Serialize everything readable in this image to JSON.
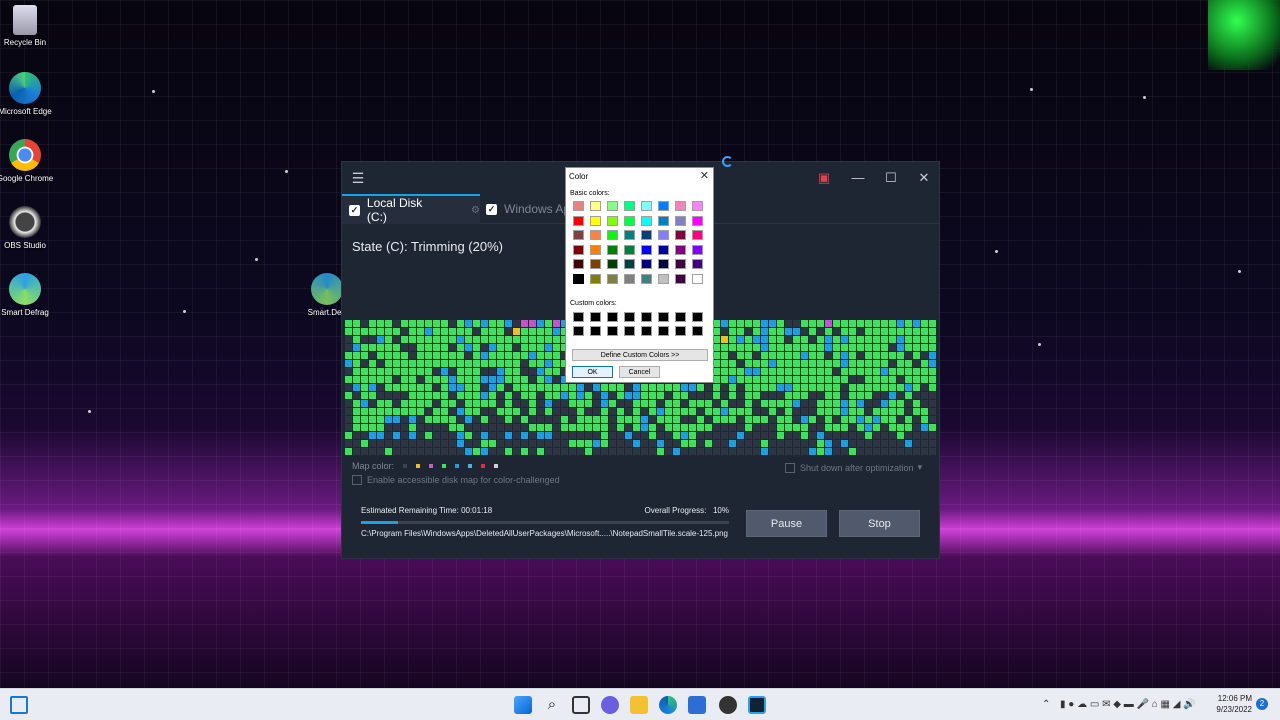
{
  "desktop": {
    "icons": [
      {
        "label": "Recycle Bin",
        "icon": "recycle-bin-icon"
      },
      {
        "label": "Microsoft Edge",
        "icon": "edge-icon"
      },
      {
        "label": "Google Chrome",
        "icon": "chrome-icon"
      },
      {
        "label": "OBS Studio",
        "icon": "obs-icon"
      },
      {
        "label": "Smart Defrag",
        "icon": "smart-defrag-icon"
      },
      {
        "label": "Smart.Defr",
        "icon": "smart-defrag-icon"
      }
    ]
  },
  "window": {
    "tabs": [
      {
        "label": "Local Disk (C:)",
        "checked": true
      },
      {
        "label": "Windows App",
        "checked": true
      }
    ],
    "state": "State (C): Trimming (20%)",
    "map_color_label": "Map color:",
    "map_colors": [
      "#3a4252",
      "#f0c020",
      "#c060c0",
      "#40e060",
      "#1ca0e0",
      "#50b0d0",
      "#e03040",
      "#d0d0e0"
    ],
    "accessible_label": "Enable accessible disk map for color-challenged",
    "shutdown_label": "Shut down after optimization",
    "remaining_label": "Estimated Remaining Time:",
    "remaining_value": "00:01:18",
    "overall_label": "Overall Progress:",
    "overall_value": "10%",
    "overall_fraction": 0.1,
    "current_file": "C:\\Program Files\\WindowsApps\\DeletedAllUserPackages\\Microsoft.....\\NotepadSmallTile.scale-125.png",
    "pause_label": "Pause",
    "stop_label": "Stop",
    "colors": {
      "free": "#2e3542",
      "used": "#3be25a",
      "fragmented": "#1c9fe0",
      "system": "#c155c8",
      "optimized": "#f0c020"
    }
  },
  "color_dialog": {
    "title": "Color",
    "basic_label": "Basic colors:",
    "custom_label": "Custom colors:",
    "define_label": "Define Custom Colors >>",
    "ok_label": "OK",
    "cancel_label": "Cancel",
    "basic_colors": [
      "#f08080",
      "#ffff80",
      "#80ff80",
      "#00ff80",
      "#80ffff",
      "#0080ff",
      "#ff80c0",
      "#ff80ff",
      "#ff0000",
      "#ffff00",
      "#80ff00",
      "#00ff40",
      "#00ffff",
      "#0080c0",
      "#8080c0",
      "#ff00ff",
      "#804040",
      "#ff8040",
      "#00ff00",
      "#008080",
      "#004080",
      "#8080ff",
      "#800040",
      "#ff0080",
      "#800000",
      "#ff8000",
      "#008000",
      "#008040",
      "#0000ff",
      "#0000a0",
      "#800080",
      "#8000ff",
      "#400000",
      "#804000",
      "#004000",
      "#004040",
      "#000080",
      "#000040",
      "#400040",
      "#400080",
      "#000000",
      "#808000",
      "#808040",
      "#808080",
      "#408080",
      "#c0c0c0",
      "#400040",
      "#ffffff"
    ],
    "custom_colors": [
      "#000000",
      "#000000",
      "#000000",
      "#000000",
      "#000000",
      "#000000",
      "#000000",
      "#000000",
      "#000000",
      "#000000",
      "#000000",
      "#000000",
      "#000000",
      "#000000",
      "#000000",
      "#000000"
    ]
  },
  "taskbar": {
    "time": "12:06 PM",
    "date": "9/23/2022",
    "notification_count": "2",
    "apps": [
      "start-icon",
      "search-icon",
      "task-view-icon",
      "chat-icon",
      "file-explorer-icon",
      "edge-icon",
      "store-icon",
      "obs-icon",
      "smart-defrag-icon"
    ]
  }
}
